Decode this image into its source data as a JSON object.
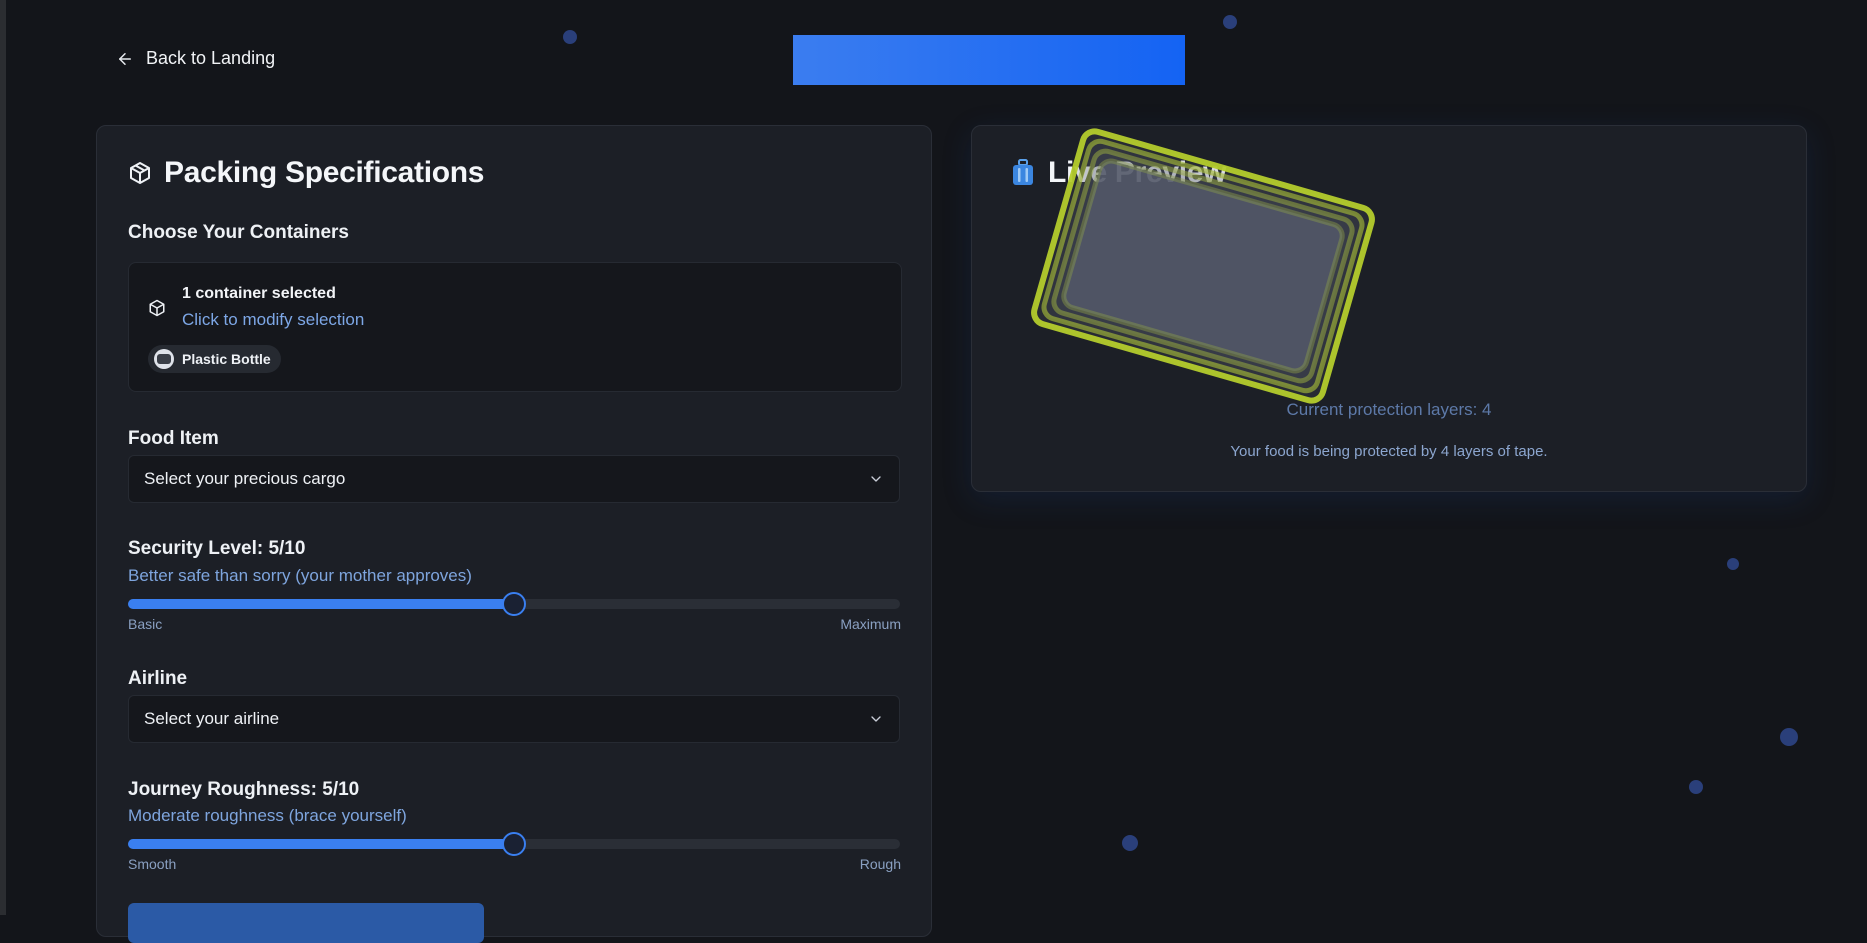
{
  "nav": {
    "back_label": "Back to Landing"
  },
  "colors": {
    "accent": "#3a7ff0",
    "tape": "#b4cc2c",
    "background": "#13151a",
    "panel": "#1c1f26"
  },
  "specs": {
    "title": "Packing Specifications",
    "title_icon": "package-icon",
    "containers": {
      "label": "Choose Your Containers",
      "count_text": "1 container selected",
      "modify_text": "Click to modify selection",
      "chips": [
        {
          "label": "Plastic Bottle"
        }
      ]
    },
    "food": {
      "label": "Food Item",
      "value": "Select your precious cargo"
    },
    "security": {
      "label": "Security Level: 5/10",
      "hint": "Better safe than sorry (your mother approves)",
      "value": 5,
      "max": 10,
      "min_label": "Basic",
      "max_label": "Maximum"
    },
    "airline": {
      "label": "Airline",
      "value": "Select your airline"
    },
    "roughness": {
      "label": "Journey Roughness: 5/10",
      "hint": "Moderate roughness (brace yourself)",
      "value": 5,
      "max": 10,
      "min_label": "Smooth",
      "max_label": "Rough"
    }
  },
  "preview": {
    "title": "Live Preview",
    "title_icon": "luggage-icon",
    "layers_text": "Current protection layers: 4",
    "protected_text": "Your food is being protected by 4 layers of tape.",
    "layers": 4
  }
}
